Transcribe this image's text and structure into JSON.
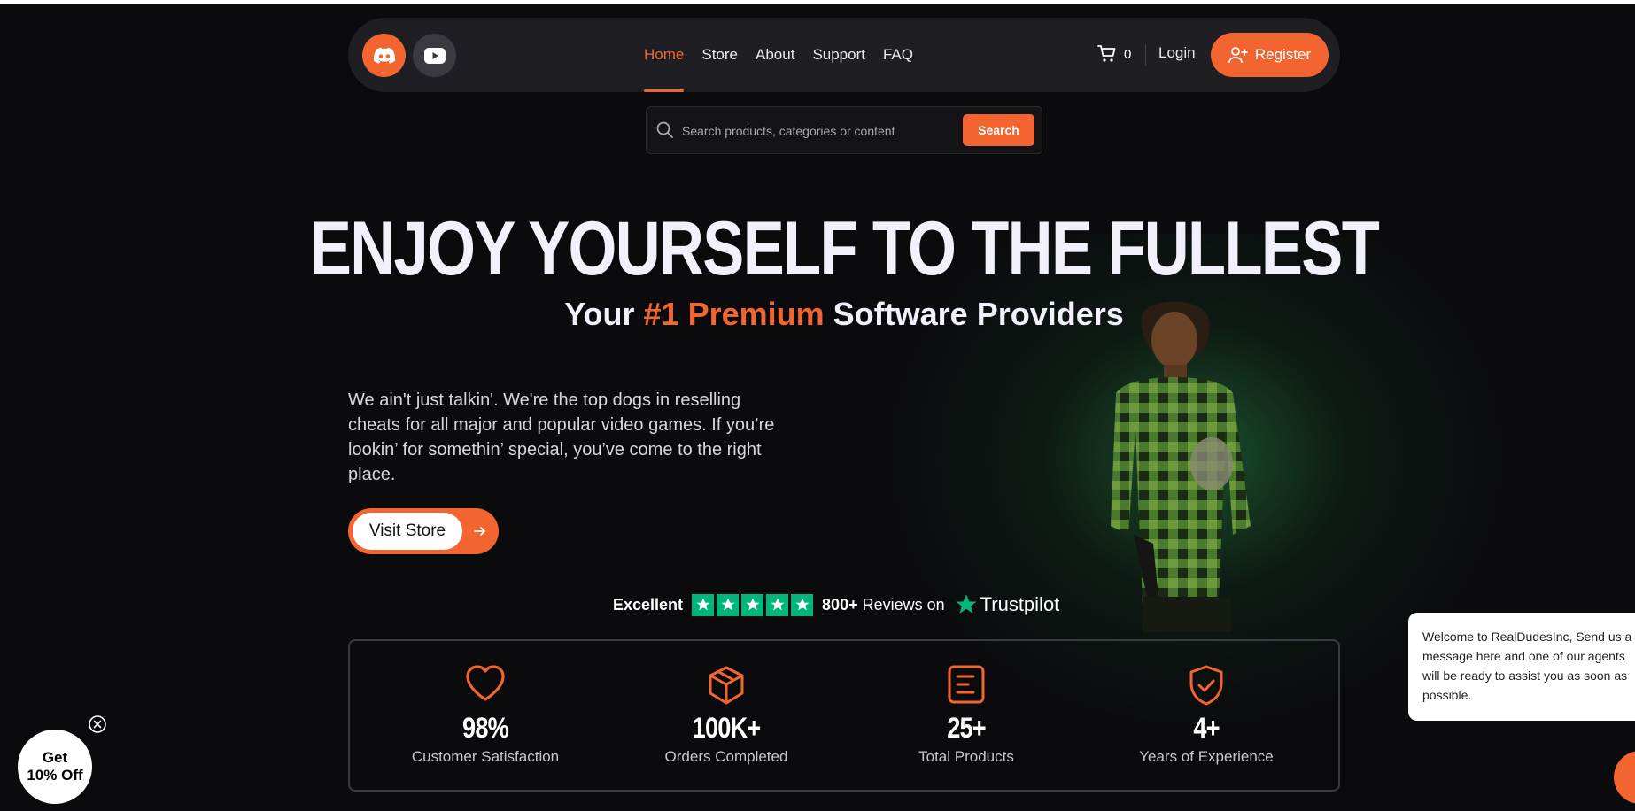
{
  "nav": {
    "links": [
      {
        "label": "Home",
        "active": true
      },
      {
        "label": "Store",
        "active": false
      },
      {
        "label": "About",
        "active": false
      },
      {
        "label": "Support",
        "active": false
      },
      {
        "label": "FAQ",
        "active": false
      }
    ],
    "cart_count": "0",
    "login_label": "Login",
    "register_label": "Register",
    "social": [
      "discord-icon",
      "youtube-icon"
    ]
  },
  "search": {
    "placeholder": "Search products, categories or content",
    "button_label": "Search"
  },
  "hero": {
    "headline": "ENJOY YOURSELF TO THE FULLEST",
    "sub_prefix": "Your ",
    "sub_accent": "#1 Premium",
    "sub_suffix": " Software Providers",
    "blurb": "We ain't just talkin'. We're the top dogs in reselling cheats for all major and popular video games. If you’re lookin’ for somethin’ special, you’ve come to the right place.",
    "cta_label": "Visit Store"
  },
  "trust": {
    "rating_word": "Excellent",
    "stars": 5,
    "reviews_count": "800+",
    "reviews_text": " Reviews on",
    "brand": "Trustpilot"
  },
  "stats": [
    {
      "icon": "heart-icon",
      "value": "98%",
      "label": "Customer Satisfaction"
    },
    {
      "icon": "box-icon",
      "value": "100K+",
      "label": "Orders Completed"
    },
    {
      "icon": "list-icon",
      "value": "25+",
      "label": "Total Products"
    },
    {
      "icon": "shield-check-icon",
      "value": "4+",
      "label": "Years of Experience"
    }
  ],
  "discount": {
    "line1": "Get",
    "line2": "10% Off"
  },
  "chat": {
    "message": "Welcome to RealDudesInc, Send us a message here and one of our agents will be ready to assist you as soon as possible."
  },
  "colors": {
    "accent": "#f26430",
    "background": "#0b0b0e",
    "trustpilot": "#00b67a"
  }
}
